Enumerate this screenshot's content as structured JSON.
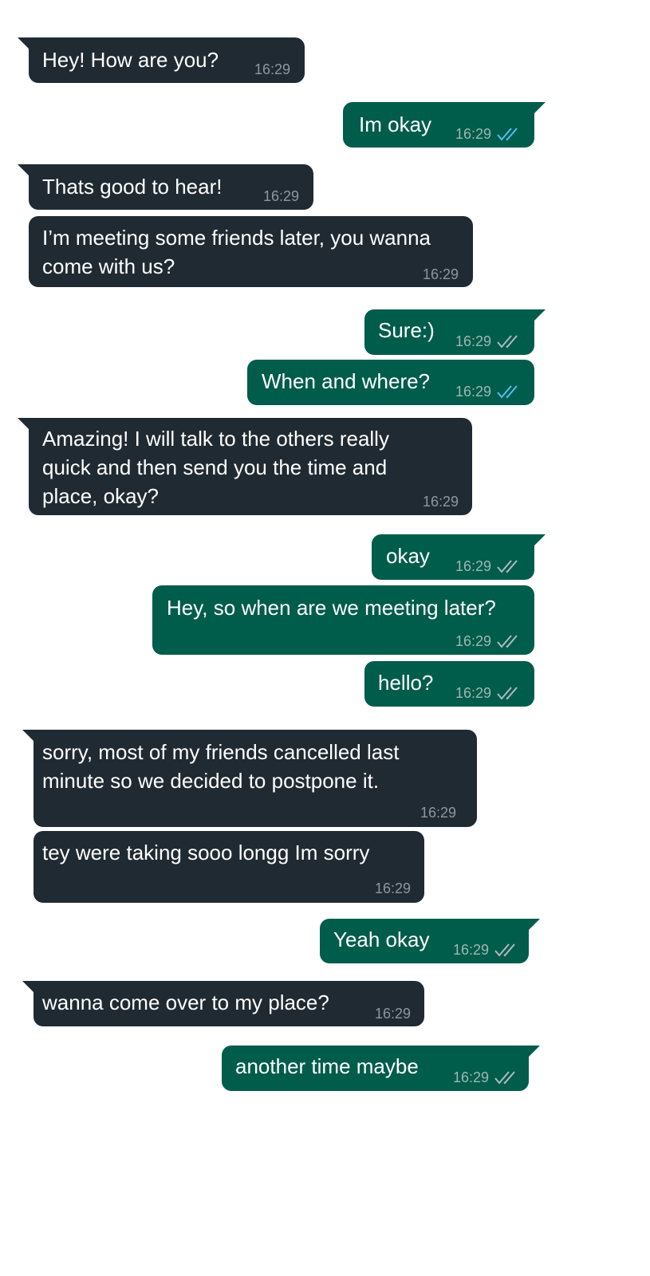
{
  "colors": {
    "incoming_bubble": "#202a32",
    "outgoing_bubble": "#005c4b",
    "read_tick": "#53bdeb",
    "delivered_tick": "#aebac1",
    "timestamp": "#8e979c"
  },
  "messages": [
    {
      "direction": "incoming",
      "text": "Hey! How are you?",
      "time": "16:29"
    },
    {
      "direction": "outgoing",
      "text": "Im okay",
      "time": "16:29",
      "status": "read"
    },
    {
      "direction": "incoming",
      "text": "Thats good to hear!",
      "time": "16:29"
    },
    {
      "direction": "incoming",
      "text": "I’m meeting some friends later, you wanna come with us?",
      "time": "16:29"
    },
    {
      "direction": "outgoing",
      "text": "Sure:)",
      "time": "16:29",
      "status": "delivered"
    },
    {
      "direction": "outgoing",
      "text": "When and where?",
      "time": "16:29",
      "status": "read"
    },
    {
      "direction": "incoming",
      "text": "Amazing! I will talk to the others really quick and then send you the time and place, okay?",
      "time": "16:29"
    },
    {
      "direction": "outgoing",
      "text": "okay",
      "time": "16:29",
      "status": "delivered"
    },
    {
      "direction": "outgoing",
      "text": "Hey, so when are we meeting later?",
      "time": "16:29",
      "status": "delivered"
    },
    {
      "direction": "outgoing",
      "text": "hello?",
      "time": "16:29",
      "status": "delivered"
    },
    {
      "direction": "incoming",
      "text": "sorry, most of my friends cancelled last minute so we decided to postpone it.",
      "time": "16:29"
    },
    {
      "direction": "incoming",
      "text": "tey were taking sooo longg Im sorry",
      "time": "16:29"
    },
    {
      "direction": "outgoing",
      "text": "Yeah okay",
      "time": "16:29",
      "status": "delivered"
    },
    {
      "direction": "incoming",
      "text": "wanna come over to my place?",
      "time": "16:29"
    },
    {
      "direction": "outgoing",
      "text": "another time maybe",
      "time": "16:29",
      "status": "delivered"
    }
  ]
}
